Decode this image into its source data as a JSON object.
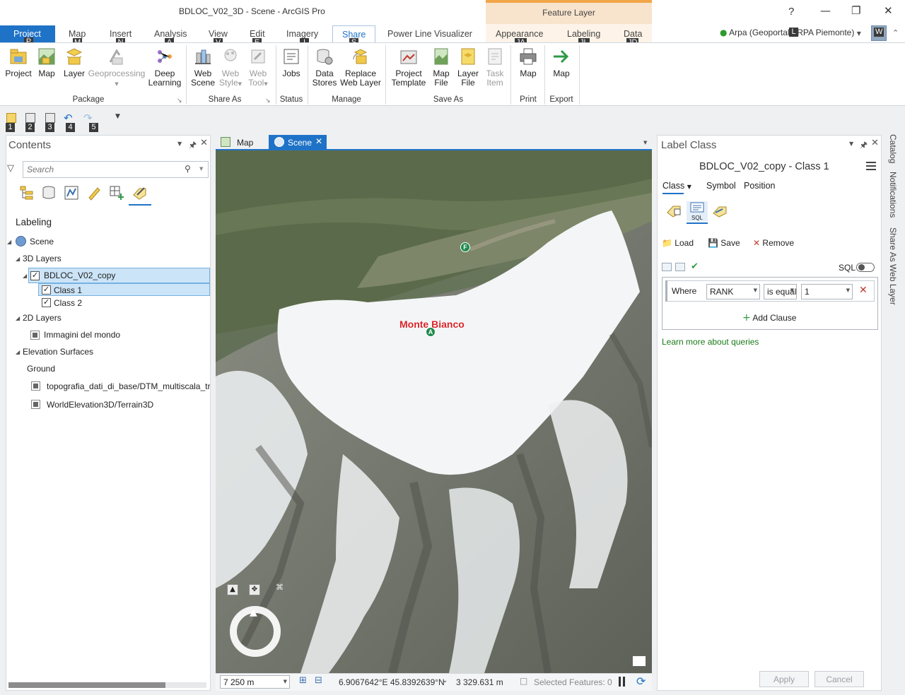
{
  "window": {
    "title": "BDLOC_V02_3D - Scene - ArcGIS Pro",
    "context_header": "Feature Layer",
    "help": "?",
    "minimize": "—",
    "maximize": "❐",
    "close": "✕"
  },
  "tabs": {
    "project": "Project",
    "map": "Map",
    "insert": "Insert",
    "analysis": "Analysis",
    "view": "View",
    "edit": "Edit",
    "imagery": "Imagery",
    "share": "Share",
    "power_line": "Power Line Visualizer",
    "appearance": "Appearance",
    "labeling": "Labeling",
    "data": "Data"
  },
  "keytips": {
    "project": "P",
    "map": "M",
    "insert": "N",
    "analysis": "A",
    "view": "V",
    "edit": "E",
    "imagery": "I",
    "share": "S",
    "appearance": "JA",
    "labeling": "JL",
    "data": "JD",
    "user": "L",
    "avatar": "W",
    "qat1": "1",
    "qat2": "2",
    "qat3": "3",
    "qat4": "4",
    "qat5": "5"
  },
  "user": {
    "name": "Arpa (Geoportal ARPA Piemonte)",
    "avatar_initial": "W"
  },
  "ribbon": {
    "package": {
      "label": "Package",
      "project": "Project",
      "map": "Map",
      "layer": "Layer",
      "geoprocessing": "Geoprocessing",
      "deep_learning_1": "Deep",
      "deep_learning_2": "Learning"
    },
    "share_as": {
      "label": "Share As",
      "web_scene_1": "Web",
      "web_scene_2": "Scene",
      "web_style_1": "Web",
      "web_style_2": "Style",
      "web_tool_1": "Web",
      "web_tool_2": "Tool"
    },
    "status": {
      "label": "Status",
      "jobs": "Jobs"
    },
    "manage": {
      "label": "Manage",
      "data_stores_1": "Data",
      "data_stores_2": "Stores",
      "replace_1": "Replace",
      "replace_2": "Web Layer"
    },
    "save_as": {
      "label": "Save As",
      "project_template_1": "Project",
      "project_template_2": "Template",
      "map_file_1": "Map",
      "map_file_2": "File",
      "layer_file_1": "Layer",
      "layer_file_2": "File",
      "task_item_1": "Task",
      "task_item_2": "Item"
    },
    "print": {
      "label": "Print",
      "map": "Map"
    },
    "export": {
      "label": "Export",
      "map": "Map"
    }
  },
  "contents": {
    "title": "Contents",
    "search_placeholder": "Search",
    "view_label": "Labeling",
    "tree": {
      "scene": "Scene",
      "layers_3d": "3D Layers",
      "bdloc": "BDLOC_V02_copy",
      "class1": "Class 1",
      "class2": "Class 2",
      "layers_2d": "2D Layers",
      "immagini": "Immagini del mondo",
      "elevation": "Elevation Surfaces",
      "ground": "Ground",
      "dtm": "topografia_dati_di_base/DTM_multiscala_tra",
      "world_elev": "WorldElevation3D/Terrain3D"
    }
  },
  "view": {
    "tab_map": "Map",
    "tab_scene": "Scene",
    "label_monte_bianco": "Monte Bianco",
    "marker_a": "A",
    "marker_f": "F"
  },
  "status": {
    "scale": "7 250 m",
    "coords": "6.9067642°E 45.8392639°N",
    "elevation": "3 329.631 m",
    "selected": "Selected Features: 0"
  },
  "label_class": {
    "pane_title": "Label Class",
    "layer_class": "BDLOC_V02_copy - Class 1",
    "tab_class": "Class",
    "tab_symbol": "Symbol",
    "tab_position": "Position",
    "sql_icon_text": "SQL",
    "load": "Load",
    "save": "Save",
    "remove": "Remove",
    "sql_label": "SQL",
    "where": "Where",
    "field": "RANK",
    "operator": "is equal to",
    "value": "1",
    "add_clause": "Add Clause",
    "learn_more": "Learn more about queries",
    "apply": "Apply",
    "cancel": "Cancel"
  },
  "side_tabs": {
    "catalog": "Catalog",
    "notifications": "Notifications",
    "share_web_layer": "Share As Web Layer"
  },
  "colors": {
    "accent": "#1f73c7",
    "context_tab": "#f2a64a",
    "link_green": "#1a7a1a",
    "label_red": "#d9252b"
  }
}
